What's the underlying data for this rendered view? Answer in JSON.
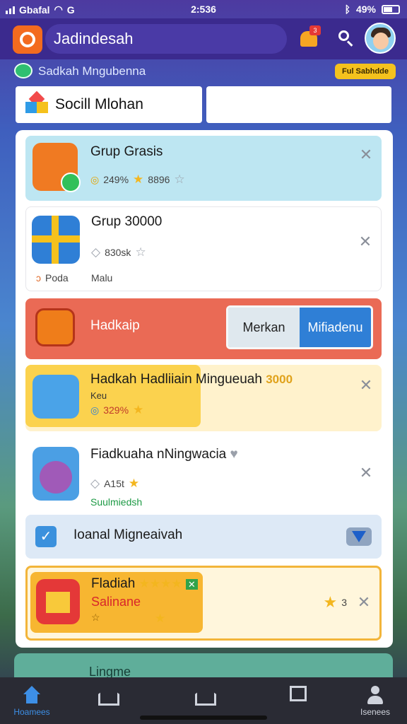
{
  "status_bar": {
    "carrier": "Gbafal",
    "carrier_g": "G",
    "time": "2:536",
    "battery": "49%"
  },
  "header": {
    "title": "Jadindesah",
    "notification_badge": "3"
  },
  "sub_header": {
    "title": "Sadkah Mngubenna",
    "button_label": "Ful Sabhdde"
  },
  "category": {
    "left_label": "Socill Mlohan",
    "right_label": ""
  },
  "list": {
    "row1": {
      "title": "Grup Grasis",
      "meta1": "249%",
      "meta2": "8896"
    },
    "row2": {
      "title": "Grup 30000",
      "meta1": "830sk",
      "left_tag": "Poda",
      "right_tag": "Malu"
    },
    "row3": {
      "title": "Hadkaip",
      "seg_left": "Merkan",
      "seg_right": "Mifiadenu"
    },
    "row4": {
      "title": "Hadkah Hadliiain Mingueuah",
      "title_accent": "3000",
      "sub": "Keu",
      "meta": "329%"
    },
    "row5": {
      "title": "Fiadkuaha nNingwacia",
      "meta": "A15t",
      "status": "Suulmiedsh"
    },
    "row6": {
      "title": "Ioanal Migneaivah"
    },
    "row7": {
      "title": "Fladiah",
      "subtitle": "Salinane",
      "count": "3"
    }
  },
  "teaser": {
    "label": "Lingme"
  },
  "bottom_nav": {
    "home_label": "Hoamees",
    "profile_label": "Isenees"
  },
  "colors": {
    "brand": "#3b2a8e",
    "accent": "#f36b1f",
    "selected": "#2f7fd6",
    "row3": "#ea6a55",
    "star": "#f3b61f"
  }
}
